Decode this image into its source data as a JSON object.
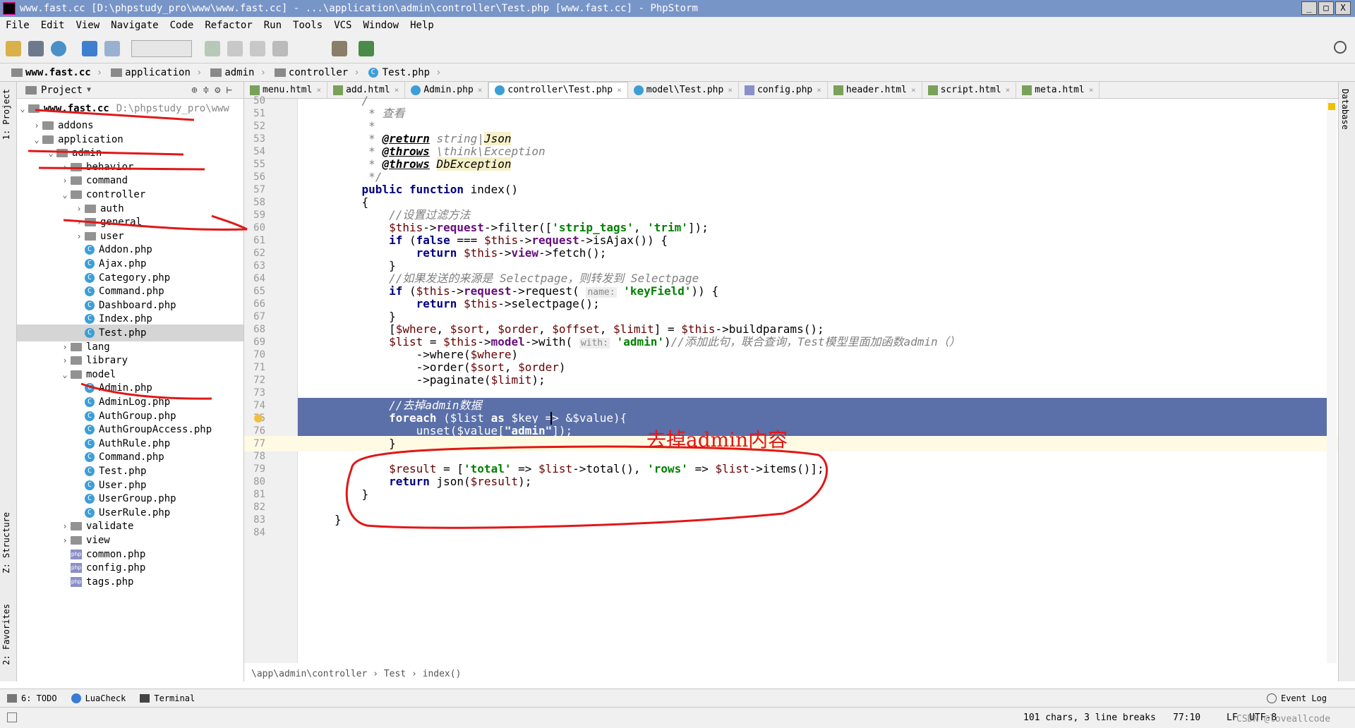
{
  "window": {
    "title": "www.fast.cc [D:\\phpstudy_pro\\www\\www.fast.cc] - ...\\application\\admin\\controller\\Test.php [www.fast.cc] - PhpStorm",
    "btn_min": "_",
    "btn_max": "□",
    "btn_close": "X"
  },
  "menu": [
    "File",
    "Edit",
    "View",
    "Navigate",
    "Code",
    "Refactor",
    "Run",
    "Tools",
    "VCS",
    "Window",
    "Help"
  ],
  "nav": {
    "crumbs": [
      "www.fast.cc",
      "application",
      "admin",
      "controller",
      "Test.php"
    ]
  },
  "sidestrip": {
    "project": "1: Project",
    "structure": "Z: Structure",
    "favorites": "2: Favorites",
    "database": "Database"
  },
  "project": {
    "header": "Project",
    "root_name": "www.fast.cc",
    "root_path": "D:\\phpstudy_pro\\www",
    "items": [
      {
        "name": "addons",
        "type": "folder",
        "indent": 1,
        "arrow": "›"
      },
      {
        "name": "application",
        "type": "folder",
        "indent": 1,
        "arrow": "⌄"
      },
      {
        "name": "admin",
        "type": "folder",
        "indent": 2,
        "arrow": "⌄"
      },
      {
        "name": "behavior",
        "type": "folder",
        "indent": 3,
        "arrow": "›"
      },
      {
        "name": "command",
        "type": "folder",
        "indent": 3,
        "arrow": "›"
      },
      {
        "name": "controller",
        "type": "folder",
        "indent": 3,
        "arrow": "⌄"
      },
      {
        "name": "auth",
        "type": "folder",
        "indent": 4,
        "arrow": "›"
      },
      {
        "name": "general",
        "type": "folder",
        "indent": 4,
        "arrow": "›"
      },
      {
        "name": "user",
        "type": "folder",
        "indent": 4,
        "arrow": "›"
      },
      {
        "name": "Addon.php",
        "type": "class",
        "indent": 4,
        "arrow": ""
      },
      {
        "name": "Ajax.php",
        "type": "class",
        "indent": 4,
        "arrow": ""
      },
      {
        "name": "Category.php",
        "type": "class",
        "indent": 4,
        "arrow": ""
      },
      {
        "name": "Command.php",
        "type": "class",
        "indent": 4,
        "arrow": ""
      },
      {
        "name": "Dashboard.php",
        "type": "class",
        "indent": 4,
        "arrow": ""
      },
      {
        "name": "Index.php",
        "type": "class",
        "indent": 4,
        "arrow": ""
      },
      {
        "name": "Test.php",
        "type": "class",
        "indent": 4,
        "arrow": "",
        "selected": true
      },
      {
        "name": "lang",
        "type": "folder",
        "indent": 3,
        "arrow": "›"
      },
      {
        "name": "library",
        "type": "folder",
        "indent": 3,
        "arrow": "›"
      },
      {
        "name": "model",
        "type": "folder",
        "indent": 3,
        "arrow": "⌄"
      },
      {
        "name": "Admin.php",
        "type": "class",
        "indent": 4,
        "arrow": ""
      },
      {
        "name": "AdminLog.php",
        "type": "class",
        "indent": 4,
        "arrow": ""
      },
      {
        "name": "AuthGroup.php",
        "type": "class",
        "indent": 4,
        "arrow": ""
      },
      {
        "name": "AuthGroupAccess.php",
        "type": "class",
        "indent": 4,
        "arrow": ""
      },
      {
        "name": "AuthRule.php",
        "type": "class",
        "indent": 4,
        "arrow": ""
      },
      {
        "name": "Command.php",
        "type": "class",
        "indent": 4,
        "arrow": ""
      },
      {
        "name": "Test.php",
        "type": "class",
        "indent": 4,
        "arrow": ""
      },
      {
        "name": "User.php",
        "type": "class",
        "indent": 4,
        "arrow": ""
      },
      {
        "name": "UserGroup.php",
        "type": "class",
        "indent": 4,
        "arrow": ""
      },
      {
        "name": "UserRule.php",
        "type": "class",
        "indent": 4,
        "arrow": ""
      },
      {
        "name": "validate",
        "type": "folder",
        "indent": 3,
        "arrow": "›"
      },
      {
        "name": "view",
        "type": "folder",
        "indent": 3,
        "arrow": "›"
      },
      {
        "name": "common.php",
        "type": "php",
        "indent": 3,
        "arrow": ""
      },
      {
        "name": "config.php",
        "type": "php",
        "indent": 3,
        "arrow": ""
      },
      {
        "name": "tags.php",
        "type": "php",
        "indent": 3,
        "arrow": ""
      }
    ]
  },
  "tabs": [
    {
      "label": "menu.html",
      "icon": "html"
    },
    {
      "label": "add.html",
      "icon": "html"
    },
    {
      "label": "Admin.php",
      "icon": "class"
    },
    {
      "label": "controller\\Test.php",
      "icon": "class",
      "active": true
    },
    {
      "label": "model\\Test.php",
      "icon": "class"
    },
    {
      "label": "config.php",
      "icon": "php"
    },
    {
      "label": "header.html",
      "icon": "html"
    },
    {
      "label": "script.html",
      "icon": "html"
    },
    {
      "label": "meta.html",
      "icon": "html"
    }
  ],
  "editor": {
    "first_line": 50,
    "breadcrumb": "\\app\\admin\\controller  ›  Test  ›  index()",
    "annotation": "去掉admin内容"
  },
  "code": [
    {
      "n": "50",
      "html": "    <span class='cm'>/</span>"
    },
    {
      "n": "51",
      "html": "     <span class='cm'>* 查看</span>"
    },
    {
      "n": "52",
      "html": "     <span class='cm'>*</span>"
    },
    {
      "n": "53",
      "html": "     <span class='cm'>* <span class='tag'>@return</span> string|<span class='tagty'>Json</span></span>"
    },
    {
      "n": "54",
      "html": "     <span class='cm'>* <span class='tag'>@throws</span> \\think\\Exception</span>"
    },
    {
      "n": "55",
      "html": "     <span class='cm'>* <span class='tag'>@throws</span> <span class='tagty'>DbException</span></span>"
    },
    {
      "n": "56",
      "html": "     <span class='cm'>*/</span>"
    },
    {
      "n": "57",
      "html": "    <span class='kw'>public function</span> index()"
    },
    {
      "n": "58",
      "html": "    {"
    },
    {
      "n": "59",
      "html": "        <span class='cm'>//设置过滤方法</span>"
    },
    {
      "n": "60",
      "html": "        <span class='var'>$this</span>-><span class='mem'>request</span>->filter([<span class='str'>'strip_tags'</span>, <span class='str'>'trim'</span>]);"
    },
    {
      "n": "61",
      "html": "        <span class='kw'>if</span> (<span class='kw'>false</span> === <span class='var'>$this</span>-><span class='mem'>request</span>->isAjax()) {"
    },
    {
      "n": "62",
      "html": "            <span class='kw'>return</span> <span class='var'>$this</span>-><span class='mem'>view</span>->fetch();"
    },
    {
      "n": "63",
      "html": "        }"
    },
    {
      "n": "64",
      "html": "        <span class='cm'>//如果发送的来源是 Selectpage，则转发到 Selectpage</span>"
    },
    {
      "n": "65",
      "html": "        <span class='kw'>if</span> (<span class='var'>$this</span>-><span class='mem'>request</span>->request( <span class='prm'>name:</span> <span class='str'>'keyField'</span>)) {"
    },
    {
      "n": "66",
      "html": "            <span class='kw'>return</span> <span class='var'>$this</span>->selectpage();"
    },
    {
      "n": "67",
      "html": "        }"
    },
    {
      "n": "68",
      "html": "        [<span class='var'>$where</span>, <span class='var'>$sort</span>, <span class='var'>$order</span>, <span class='var'>$offset</span>, <span class='var'>$limit</span>] = <span class='var'>$this</span>->buildparams();"
    },
    {
      "n": "69",
      "html": "        <span class='var'>$list</span> = <span class='var'>$this</span>-><span class='mem'>model</span>->with( <span class='prm'>with:</span> <span class='str'>'admin'</span>)<span class='cm'>//添加此句，联合查询，Test模型里面加函数admin（）</span>"
    },
    {
      "n": "70",
      "html": "            ->where(<span class='var'>$where</span>)"
    },
    {
      "n": "71",
      "html": "            ->order(<span class='var'>$sort</span>, <span class='var'>$order</span>)"
    },
    {
      "n": "72",
      "html": "            ->paginate(<span class='var'>$limit</span>);"
    },
    {
      "n": "73",
      "html": ""
    },
    {
      "n": "74",
      "html": "        <span class='cm'>//去掉admin数据</span>",
      "hl": true
    },
    {
      "n": "75",
      "html": "        <span class='kw'>foreach</span> (<span class='var'>$list</span> <span class='kw'>as</span> <span class='var'>$key</span> => &amp;<span class='var'>$value</span>){",
      "hl": true
    },
    {
      "n": "76",
      "html": "            unset(<span class='var'>$value</span>[<span class='str'>\"admin\"</span>]);",
      "hl": true
    },
    {
      "n": "77",
      "html": "        }",
      "caret": true
    },
    {
      "n": "78",
      "html": ""
    },
    {
      "n": "79",
      "html": "        <span class='var'>$result</span> = [<span class='str'>'total'</span> => <span class='var'>$list</span>->total(), <span class='str'>'rows'</span> => <span class='var'>$list</span>->items()];"
    },
    {
      "n": "80",
      "html": "        <span class='kw'>return</span> json(<span class='var'>$result</span>);"
    },
    {
      "n": "81",
      "html": "    }"
    },
    {
      "n": "82",
      "html": ""
    },
    {
      "n": "83",
      "html": "}"
    },
    {
      "n": "84",
      "html": ""
    }
  ],
  "bottom_tools": [
    "6: TODO",
    "LuaCheck",
    "Terminal"
  ],
  "event_log": "Event Log",
  "status": {
    "selection": "101 chars, 3 line breaks",
    "position": "77:10",
    "line_sep": "LF",
    "encoding": "UTF-8",
    "watermark": "CSDN @loveallcode"
  }
}
